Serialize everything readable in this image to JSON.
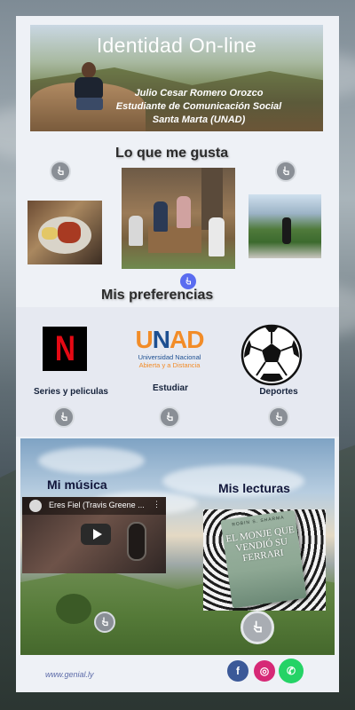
{
  "header": {
    "title": "Identidad On-line",
    "subtitle_lines": [
      "Julio Cesar Romero Orozco",
      "Estudiante de Comunicación Social",
      "Santa Marta (UNAD)"
    ]
  },
  "likes": {
    "title": "Lo que me gusta"
  },
  "preferences": {
    "title": "Mis preferencias",
    "items": [
      {
        "logo_text": "N",
        "label": "Series y peliculas"
      },
      {
        "logo_text": "UNAD",
        "logo_sub": [
          "Universidad Nacional",
          "Abierta y a Distancia"
        ],
        "label": "Estudiar"
      },
      {
        "label": "Deportes"
      }
    ]
  },
  "bottom": {
    "music_title": "Mi música",
    "reading_title": "Mis lecturas",
    "video_title": "Eres Fiel (Travis Greene ...",
    "book_author": "ROBIN S. SHARMA",
    "book_title": "EL MONJE QUE VENDIÓ SU FERRARI"
  },
  "footer": {
    "link": "www.genial.ly",
    "social": [
      "f",
      "◎",
      "✆"
    ]
  },
  "colors": {
    "netflix_red": "#e50914",
    "unad_orange": "#f28c28",
    "unad_blue": "#1d4f91",
    "accent_blue": "#5a6cf0",
    "facebook": "#3b5998",
    "instagram": "#d62976",
    "whatsapp": "#25d366"
  },
  "icons": {
    "touch": "hand-pointer-icon",
    "play": "play-icon"
  }
}
